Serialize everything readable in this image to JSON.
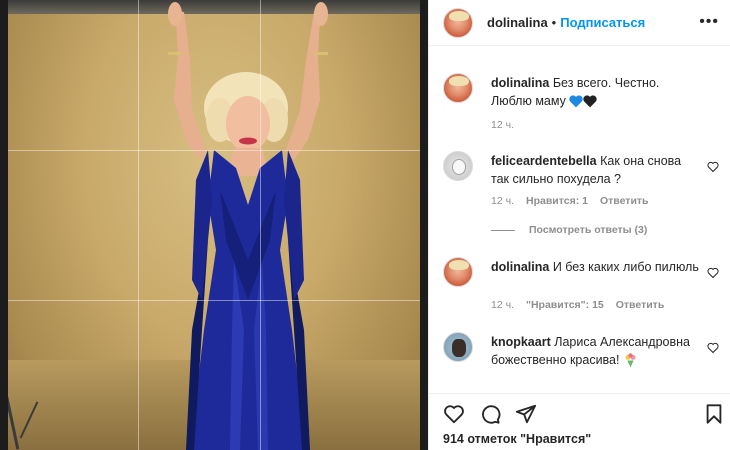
{
  "post": {
    "author": "dolinalina",
    "follow_label": "Подписаться",
    "separator": "•",
    "more_label": "•••"
  },
  "comments": [
    {
      "username": "dolinalina",
      "text": "Без всего. Честно. Люблю маму",
      "emoji": [
        "blue-heart",
        "black-heart"
      ],
      "time": "12 ч."
    },
    {
      "username": "feliceardentebella",
      "text": "Как она снова так сильно похудела ?",
      "time": "12 ч.",
      "likes_label": "Нравится: 1",
      "reply_label": "Ответить",
      "view_replies_label": "Посмотреть ответы (3)"
    },
    {
      "username": "dolinalina",
      "text": "И без каких либо пилюль",
      "time": "12 ч.",
      "likes_label": "\"Нравится\": 15",
      "reply_label": "Ответить"
    },
    {
      "username": "knopkaart",
      "text": "Лариса Александровна божественно красива!",
      "emoji": [
        "bouquet"
      ]
    }
  ],
  "actions": {
    "likes_count": "914 отметок \"Нравится\"",
    "icons": [
      "heart-icon",
      "comment-icon",
      "share-icon",
      "bookmark-icon"
    ]
  },
  "colors": {
    "link_blue": "#0095f6",
    "text": "#262626",
    "muted": "#8e8e8e",
    "dress_blue": "#1e2a9a"
  }
}
